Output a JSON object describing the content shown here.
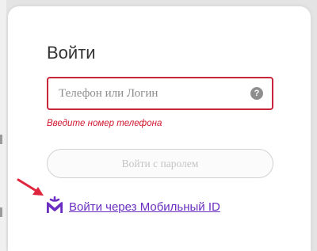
{
  "login": {
    "title": "Войти",
    "input": {
      "placeholder": "Телефон или Логин",
      "value": ""
    },
    "help_symbol": "?",
    "error": "Введите номер телефона",
    "password_button": "Войти с паролем",
    "mobile_id_link": "Войти через Мобильный ID"
  },
  "colors": {
    "error": "#d0182e",
    "input_border": "#c9253b",
    "link": "#6a2fc0",
    "arrow": "#e0263f"
  },
  "icons": {
    "help": "question-circle-icon",
    "mobile_id": "mobile-id-logo-icon",
    "annotation": "red-arrow-icon"
  }
}
